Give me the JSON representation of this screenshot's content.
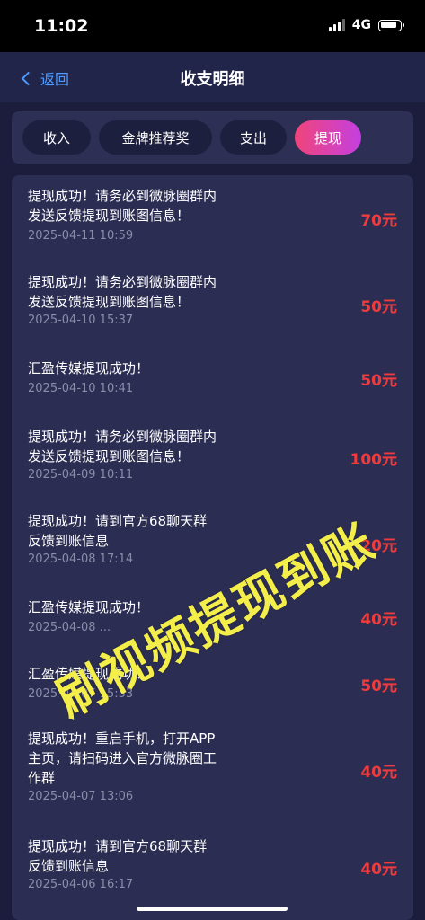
{
  "status_bar": {
    "time": "11:02",
    "network": "4G"
  },
  "nav": {
    "back_label": "返回",
    "title": "收支明细"
  },
  "tabs": [
    {
      "label": "收入",
      "active": false
    },
    {
      "label": "金牌推荐奖",
      "active": false
    },
    {
      "label": "支出",
      "active": false
    },
    {
      "label": "提现",
      "active": true
    }
  ],
  "records": [
    {
      "lines": [
        "提现成功！请务必到微脉圈群内",
        "发送反馈提现到账图信息！"
      ],
      "date": "2025-04-11 10:59",
      "amount": "70元"
    },
    {
      "lines": [
        "提现成功！请务必到微脉圈群内",
        "发送反馈提现到账图信息！"
      ],
      "date": "2025-04-10 15:37",
      "amount": "50元"
    },
    {
      "lines": [
        "汇盈传媒提现成功！"
      ],
      "date": "2025-04-10 10:41",
      "amount": "50元"
    },
    {
      "lines": [
        "提现成功！请务必到微脉圈群内",
        "发送反馈提现到账图信息！"
      ],
      "date": "2025-04-09 10:11",
      "amount": "100元"
    },
    {
      "lines": [
        "提现成功！请到官方68聊天群",
        "反馈到账信息"
      ],
      "date": "2025-04-08 17:14",
      "amount": "20元"
    },
    {
      "lines": [
        "汇盈传媒提现成功！"
      ],
      "date": "2025-04-08 ...",
      "amount": "40元"
    },
    {
      "lines": [
        "汇盈传媒提现成功！"
      ],
      "date": "2025-04-07 15:53",
      "amount": "50元"
    },
    {
      "lines": [
        "提现成功！重启手机，打开APP",
        "主页，请扫码进入官方微脉圈工",
        "作群"
      ],
      "date": "2025-04-07 13:06",
      "amount": "40元"
    },
    {
      "lines": [
        "提现成功！请到官方68聊天群",
        "反馈到账信息"
      ],
      "date": "2025-04-06 16:17",
      "amount": "40元"
    }
  ],
  "watermark": "刷视频提现到账",
  "colors": {
    "amount": "#ef3b3b",
    "accent_start": "#f0457a",
    "accent_end": "#c43fe0",
    "back": "#4d9bff",
    "watermark": "#f3ee4a"
  }
}
